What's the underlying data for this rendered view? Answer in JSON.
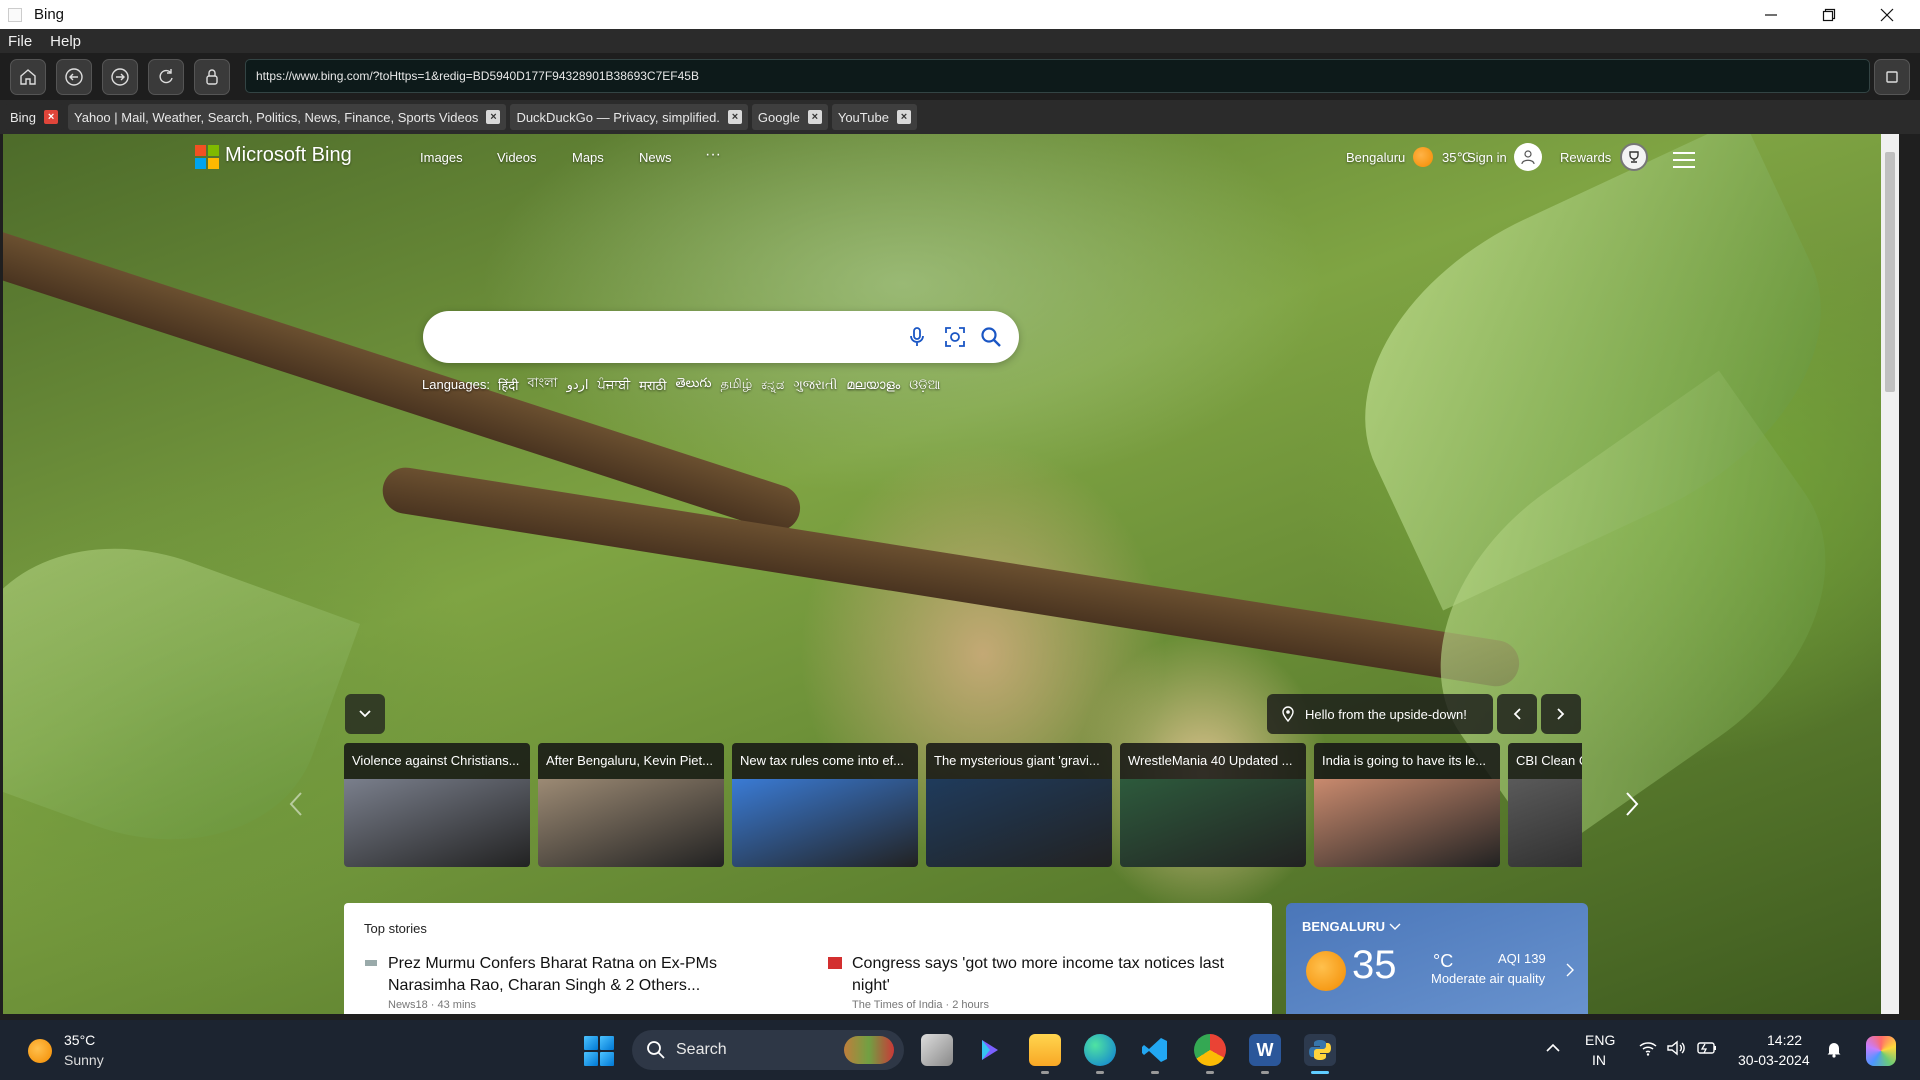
{
  "window": {
    "title": "Bing"
  },
  "menu": [
    "File",
    "Help"
  ],
  "address": {
    "url": "https://www.bing.com/?toHttps=1&redig=BD5940D177F94328901B38693C7EF45B"
  },
  "tabs": [
    {
      "label": "Bing",
      "active": true
    },
    {
      "label": "Yahoo | Mail, Weather, Search, Politics, News, Finance, Sports Videos",
      "active": false
    },
    {
      "label": "DuckDuckGo — Privacy, simplified.",
      "active": false
    },
    {
      "label": "Google",
      "active": false
    },
    {
      "label": "YouTube",
      "active": false
    }
  ],
  "bing": {
    "brand": "Microsoft Bing",
    "nav": [
      "Images",
      "Videos",
      "Maps",
      "News",
      "···"
    ],
    "location": "Bengaluru",
    "temp": "35℃",
    "sign_in": "Sign in",
    "rewards": "Rewards",
    "search_placeholder": "",
    "languages_label": "Languages:",
    "languages": [
      "हिंदी",
      "বাংলা",
      "اردو",
      "ਪੰਜਾਬੀ",
      "मराठी",
      "తెలుగు",
      "தமிழ்",
      "ಕನ್ನಡ",
      "ગુજરાતી",
      "മലയാളം",
      "ଓଡ଼ିଆ"
    ],
    "image_caption": "Hello from the upside-down!",
    "carousel": [
      {
        "caption": "Violence against Christians...",
        "color": "#7a7f8c"
      },
      {
        "caption": "After Bengaluru, Kevin Piet...",
        "color": "#9c8a74"
      },
      {
        "caption": "New tax rules come into ef...",
        "color": "#3a7bd5"
      },
      {
        "caption": "The mysterious giant 'gravi...",
        "color": "#1f3b5c"
      },
      {
        "caption": "WrestleMania 40 Updated ...",
        "color": "#2d5a3c"
      },
      {
        "caption": "India is going to have its le...",
        "color": "#c98a6e"
      },
      {
        "caption": "CBI Clean C...",
        "color": "#5a5a5a"
      }
    ],
    "top_stories": {
      "header": "Top stories",
      "items": [
        {
          "headline": "Prez Murmu Confers Bharat Ratna on Ex-PMs Narasimha Rao, Charan Singh & 2 Others...",
          "source": "News18 · 43 mins"
        },
        {
          "headline": "Congress says 'got two more income tax notices last night'",
          "source": "The Times of India · 2 hours"
        }
      ]
    },
    "weather": {
      "city": "BENGALURU",
      "temp": "35",
      "unit": "°C",
      "aqi": "AQI 139",
      "aqi_desc": "Moderate air quality"
    }
  },
  "taskbar": {
    "weather_temp": "35°C",
    "weather_desc": "Sunny",
    "search": "Search",
    "lang_top": "ENG",
    "lang_bottom": "IN",
    "time": "14:22",
    "date": "30-03-2024"
  },
  "colors": {
    "accent": "#60cdff",
    "tab_close_active": "#e0453a",
    "taskbar": "#1c2430"
  }
}
